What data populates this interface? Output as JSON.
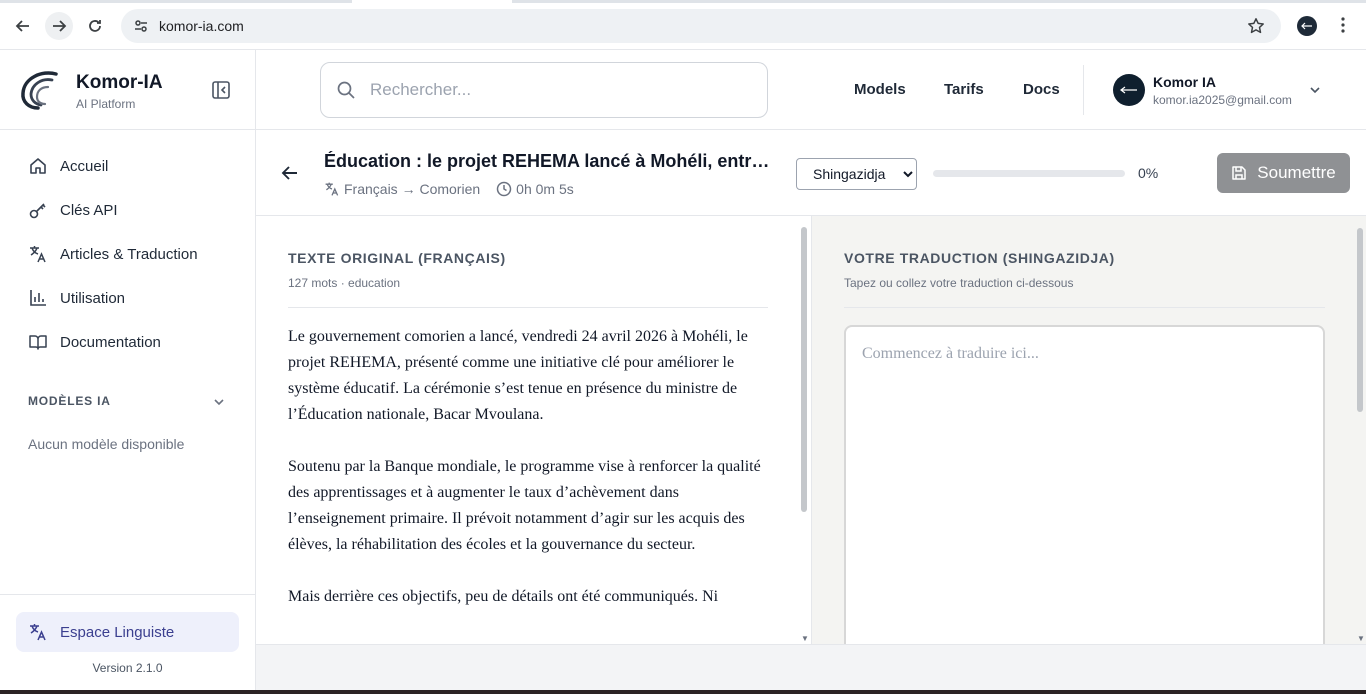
{
  "browser": {
    "url": "komor-ia.com"
  },
  "sidebar": {
    "brand_name": "Komor-IA",
    "brand_sub": "AI Platform",
    "items": [
      {
        "label": "Accueil",
        "icon": "home-icon"
      },
      {
        "label": "Clés API",
        "icon": "key-icon"
      },
      {
        "label": "Articles & Traduction",
        "icon": "translate-icon"
      },
      {
        "label": "Utilisation",
        "icon": "bar-chart-icon"
      },
      {
        "label": "Documentation",
        "icon": "book-icon"
      }
    ],
    "models_section_title": "MODÈLES IA",
    "models_empty": "Aucun modèle disponible",
    "footer_button": "Espace Linguiste",
    "version": "Version 2.1.0"
  },
  "header": {
    "search_placeholder": "Rechercher...",
    "links": [
      "Models",
      "Tarifs",
      "Docs"
    ],
    "user_name": "Komor IA",
    "user_email": "komor.ia2025@gmail.com"
  },
  "task": {
    "title": "Éducation : le projet REHEMA lancé à Mohéli, entre…",
    "lang_pair": "Français → Comorien",
    "elapsed": "0h 0m 5s",
    "target_language": "Shingazidja",
    "language_options": [
      "Shingazidja"
    ],
    "progress_percent": 0,
    "progress_label": "0%",
    "submit_label": "Soumettre"
  },
  "original": {
    "heading": "TEXTE ORIGINAL (FRANÇAIS)",
    "meta": "127 mots · education",
    "paragraphs": [
      "Le gouvernement comorien a lancé, vendredi 24 avril 2026 à Mohéli, le projet REHEMA, présenté comme une initiative clé pour améliorer le système éducatif. La cérémonie s’est tenue en présence du ministre de l’Éducation nationale, Bacar Mvoulana.",
      "Soutenu par la Banque mondiale, le programme vise à renforcer la qualité des apprentissages et à augmenter le taux d’achèvement dans l’enseignement primaire. Il prévoit notamment d’agir sur les acquis des élèves, la réhabilitation des écoles et la gouvernance du secteur.",
      "Mais derrière ces objectifs, peu de détails ont été communiqués. Ni"
    ]
  },
  "translation": {
    "heading": "VOTRE TRADUCTION (SHINGAZIDJA)",
    "hint": "Tapez ou collez votre traduction ci-dessous",
    "placeholder": "Commencez à traduire ici...",
    "value": ""
  }
}
